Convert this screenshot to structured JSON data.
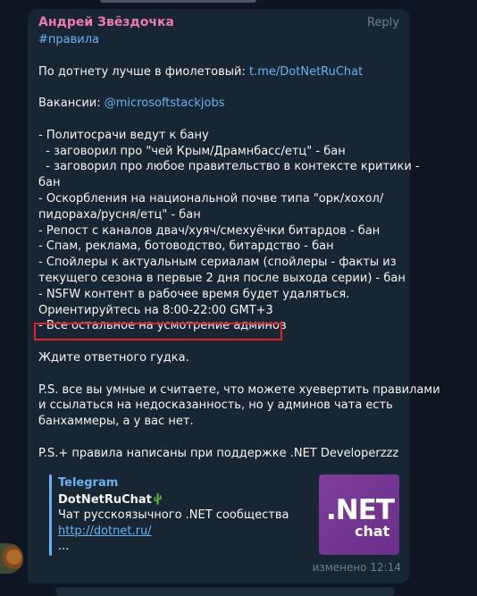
{
  "message": {
    "sender": "Андрей Звёздочка",
    "reply_label": "Reply",
    "hashtag": "#правила",
    "offtopic_prefix": "По дотнету лучше в фиолетовый: ",
    "offtopic_link": "t.me/DotNetRuChat",
    "vacancies_prefix": "Вакансии: ",
    "vacancies_link": "@microsoftstackjobs",
    "rules": [
      "- Политосрачи ведут к бану",
      "  - заговорил про \"чей Крым/Драмнбасс/етц\" - бан",
      "  - заговорил про любое правительство в контексте критики -",
      "бан",
      "- Оскорбления на национальной почве типа \"орк/хохол/",
      "пидораха/русня/етц\" - бан",
      "- Репост с каналов двач/хуяч/смехуёчки битардов - бан",
      "- Спам, реклама, ботоводство, битардство - бан",
      "- Спойлеры к актуальным сериалам (спойлеры - факты из",
      "текущего сезона в первые 2 дня после выхода серии) - бан",
      "- NSFW контент в рабочее время будет удаляться.",
      "Ориентируйтесь на 8:00-22:00 GMT+3",
      "- Все остальное на усмотрение админов"
    ],
    "wait_line": "Ждите ответного гудка.",
    "ps_lines": [
      "P.S. все вы умные и считаете, что можете хуевертить правилами",
      "и ссылаться на недосказанность, но у админов чата есть",
      "банхаммеры, а у вас нет."
    ],
    "ps_plus": "P.S.+ правила написаны при поддержке .NET Developerzzz",
    "edited_label": "изменено 12:14"
  },
  "link_preview": {
    "site": "Telegram",
    "title": "DotNetRuChat",
    "description": "Чат русскоязычного .NET сообщества",
    "url": "http://dotnet.ru/",
    "more": "...",
    "thumb_text": ".NET",
    "thumb_sub": "chat"
  },
  "colors": {
    "background": "#0e1621",
    "bubble": "#182533",
    "sender": "#ee7aae",
    "link": "#6ab3f3",
    "highlight": "#e0222a"
  }
}
